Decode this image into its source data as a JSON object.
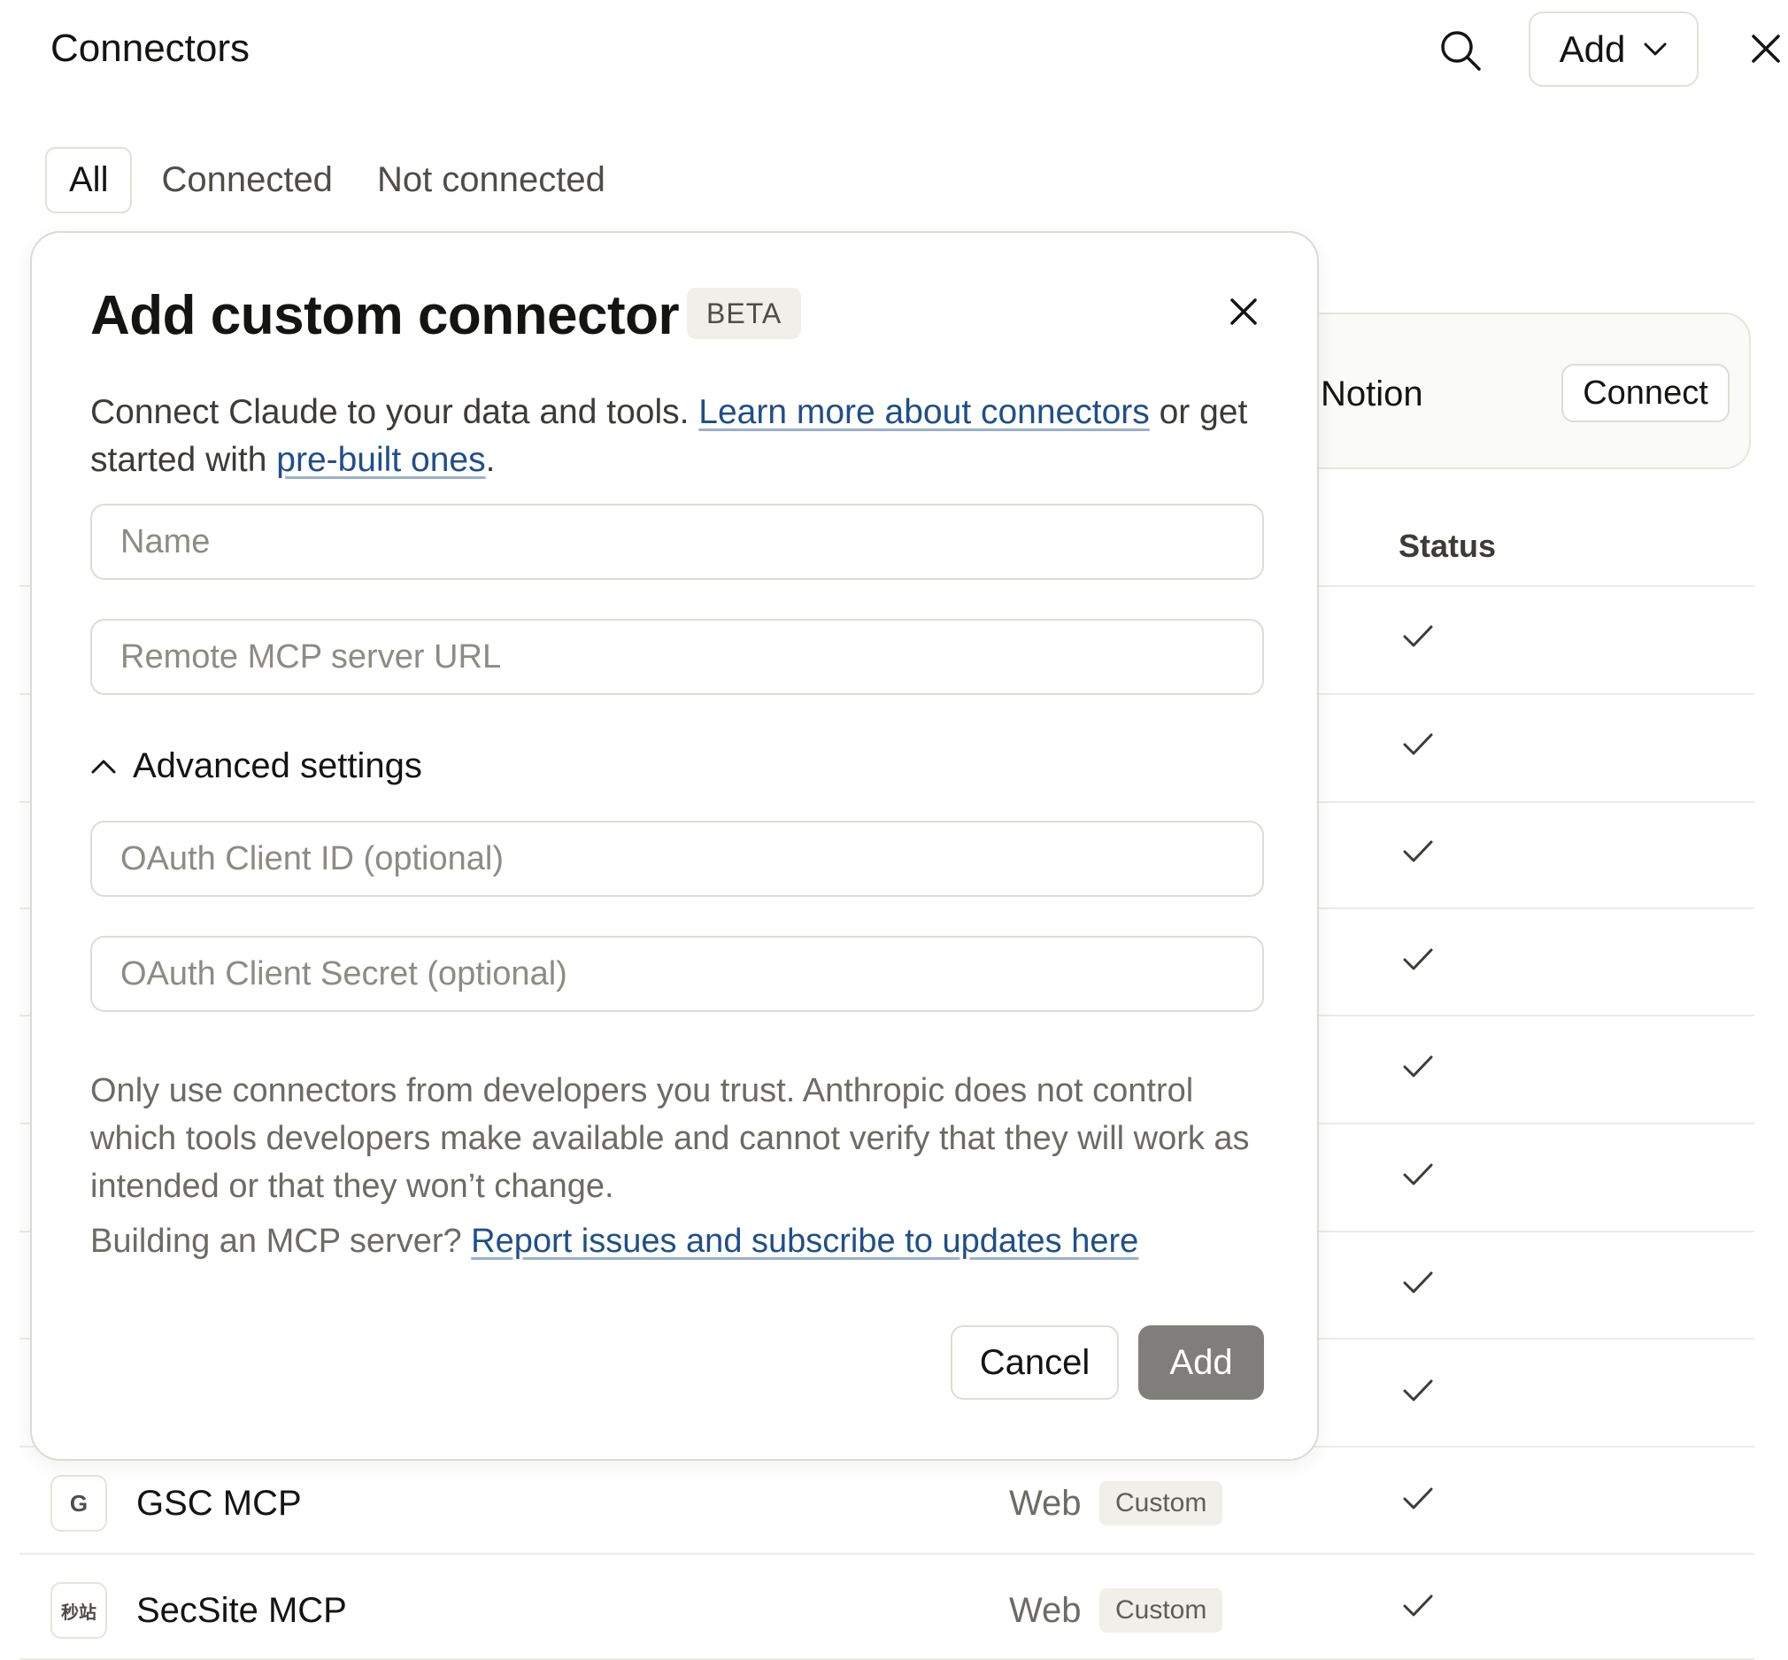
{
  "header": {
    "title": "Connectors",
    "add_label": "Add"
  },
  "tabs": [
    {
      "label": "All",
      "active": true
    },
    {
      "label": "Connected",
      "active": false
    },
    {
      "label": "Not connected",
      "active": false
    }
  ],
  "featured": {
    "name": "Notion",
    "connect_label": "Connect"
  },
  "table": {
    "status_header": "Status"
  },
  "rows": [
    {
      "avatar": "G",
      "name": "GSC MCP",
      "type": "Web",
      "badge": "Custom",
      "connected": true
    },
    {
      "avatar": "秒站",
      "name": "SecSite MCP",
      "type": "Web",
      "badge": "Custom",
      "connected": true
    }
  ],
  "modal": {
    "title": "Add custom connector",
    "badge": "BETA",
    "desc_prefix": "Connect Claude to your data and tools. ",
    "desc_link1": "Learn more about connectors",
    "desc_mid": " or get started with ",
    "desc_link2": "pre-built ones",
    "desc_suffix": ".",
    "name_placeholder": "Name",
    "url_placeholder": "Remote MCP server URL",
    "advanced_label": "Advanced settings",
    "client_id_placeholder": "OAuth Client ID (optional)",
    "client_secret_placeholder": "OAuth Client Secret (optional)",
    "warning": "Only use connectors from developers you trust. Anthropic does not control which tools developers make available and cannot verify that they will work as intended or that they won’t change.",
    "building_prefix": "Building an MCP server? ",
    "building_link": "Report issues and subscribe to updates here",
    "cancel_label": "Cancel",
    "add_label": "Add"
  },
  "colors": {
    "link": "#1f4f8a",
    "add_button_disabled": "#7f7e7a",
    "border": "#dedcd5"
  }
}
